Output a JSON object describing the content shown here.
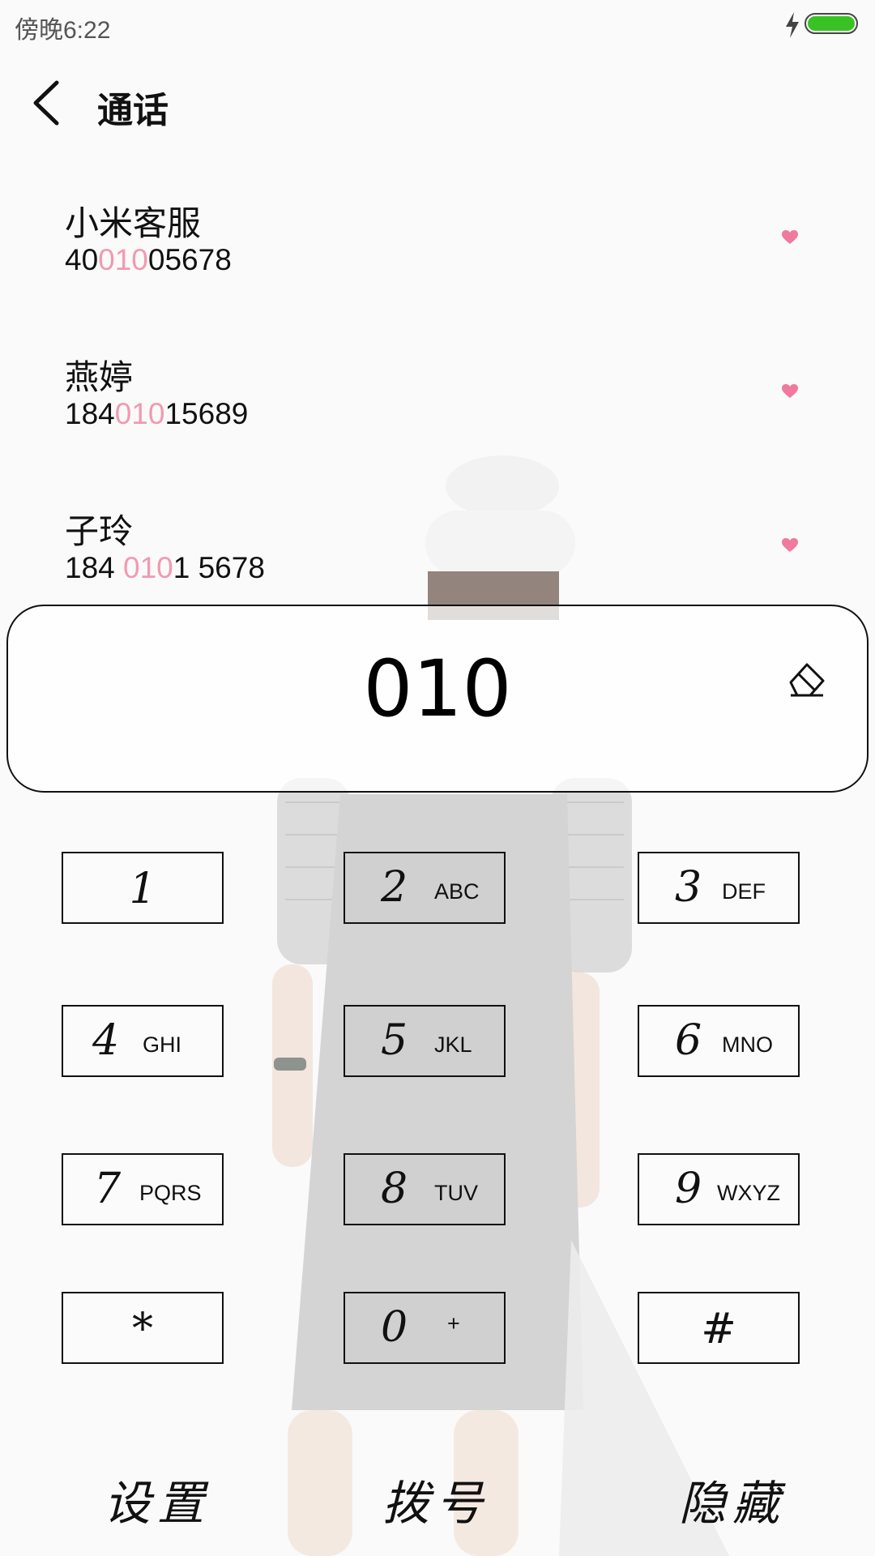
{
  "status_bar": {
    "time": "傍晚6:22",
    "battery_color": "#39c224"
  },
  "header": {
    "title": "通话",
    "back_icon": "back-arrow-icon"
  },
  "contacts": [
    {
      "name": "小米客服",
      "number_pre": "40",
      "number_match": "010",
      "number_post": "05678"
    },
    {
      "name": "燕婷",
      "number_pre": "184",
      "number_match": "010",
      "number_post": "15689"
    },
    {
      "name": "子玲",
      "number_pre": "184 ",
      "number_match": "010",
      "number_post": "1 5678"
    }
  ],
  "highlight_color": "#f19ab2",
  "input": {
    "value": "010",
    "clear_icon": "eraser-icon"
  },
  "keypad": [
    {
      "digit": "1",
      "letters": ""
    },
    {
      "digit": "2",
      "letters": "ABC"
    },
    {
      "digit": "3",
      "letters": "DEF"
    },
    {
      "digit": "4",
      "letters": "GHI"
    },
    {
      "digit": "5",
      "letters": "JKL"
    },
    {
      "digit": "6",
      "letters": "MNO"
    },
    {
      "digit": "7",
      "letters": "PQRS"
    },
    {
      "digit": "8",
      "letters": "TUV"
    },
    {
      "digit": "9",
      "letters": "WXYZ"
    },
    {
      "digit": "*",
      "letters": ""
    },
    {
      "digit": "0",
      "letters": "+"
    },
    {
      "digit": "#",
      "letters": ""
    }
  ],
  "actions": {
    "settings": "设置",
    "dial": "拨号",
    "hide": "隐藏"
  }
}
